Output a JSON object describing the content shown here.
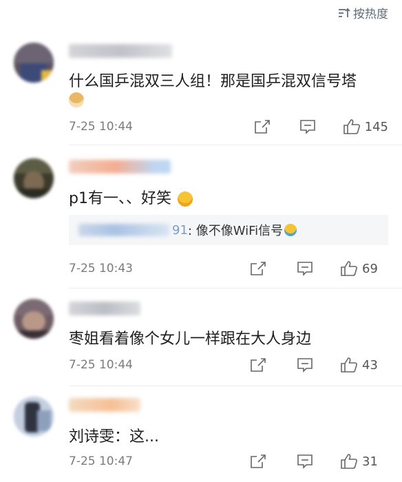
{
  "sort": {
    "label": "按热度"
  },
  "comments": [
    {
      "text": "什么国乒混双三人组！那是国乒混双信号塔",
      "emoji": "doge-emoji",
      "time": "7-25 10:44",
      "likes": "145"
    },
    {
      "text": "p1有一、、好笑",
      "emoji": "covering-mouth-laugh-emoji",
      "reply": {
        "name_suffix": "91",
        "text": ": 像不像WiFi信号",
        "emoji": "laughing-tears-emoji"
      },
      "time": "7-25 10:43",
      "likes": "69"
    },
    {
      "text": "枣姐看着像个女儿一样跟在大人身边",
      "time": "7-25 10:44",
      "likes": "43"
    },
    {
      "text": "刘诗雯：这...",
      "time": "7-25 10:47",
      "likes": "31"
    }
  ],
  "icons": {
    "share": "share-icon",
    "comment": "comment-icon",
    "like": "thumbs-up-icon",
    "sort": "sort-icon"
  }
}
